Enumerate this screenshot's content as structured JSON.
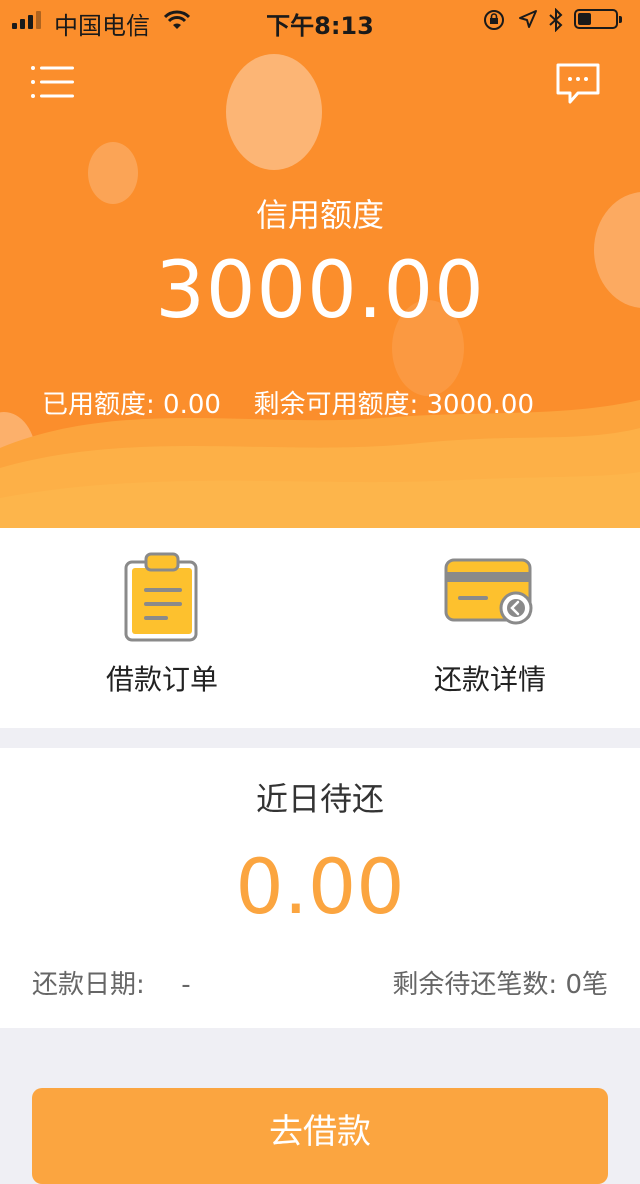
{
  "status_bar": {
    "carrier": "中国电信",
    "time": "下午8:13",
    "battery_level": 0.35
  },
  "header": {
    "menu_icon": "list-menu-icon",
    "message_icon": "chat-bubble-icon"
  },
  "credit": {
    "label": "信用额度",
    "amount": "3000.00",
    "used_label": "已用额度:",
    "used_value": "0.00",
    "remaining_label": "剩余可用额度:",
    "remaining_value": "3000.00"
  },
  "shortcuts": {
    "orders": {
      "label": "借款订单",
      "icon": "clipboard-icon"
    },
    "repayment": {
      "label": "还款详情",
      "icon": "card-return-icon"
    }
  },
  "due": {
    "title": "近日待还",
    "amount": "0.00",
    "date_label": "还款日期:",
    "date_value": "-",
    "count_label": "剩余待还笔数:",
    "count_value": "0笔"
  },
  "actions": {
    "borrow_label": "去借款"
  },
  "colors": {
    "brand_orange": "#fb8e2c",
    "accent_amount": "#fba540",
    "icon_yellow": "#fdc12e"
  }
}
